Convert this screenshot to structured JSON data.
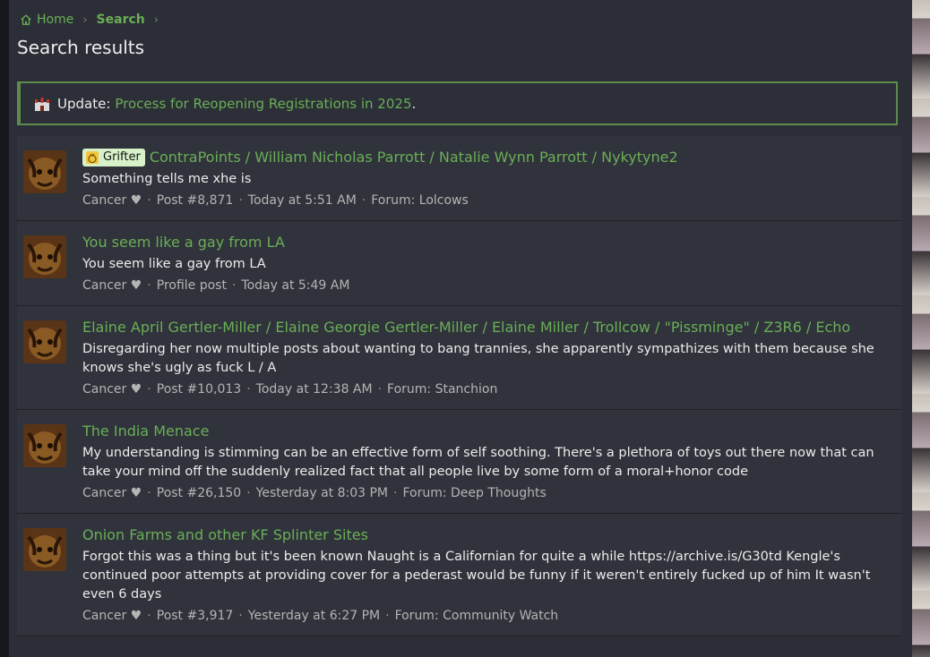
{
  "breadcrumb": {
    "home": "Home",
    "search": "Search"
  },
  "page_title": "Search results",
  "notice": {
    "lead": "Update:",
    "link": "Process for Reopening Registrations in 2025",
    "trail": "."
  },
  "results": [
    {
      "badge": "Grifter",
      "title": "ContraPoints / William Nicholas Parrott / Natalie Wynn Parrott / Nykytyne2",
      "snippet": "Something tells me xhe is",
      "author": "Cancer ♥",
      "type": "Post #8,871",
      "time": "Today at 5:51 AM",
      "forum": "Forum: Lolcows"
    },
    {
      "badge": "",
      "title": "You seem like a gay from LA",
      "snippet": "You seem like a gay from LA",
      "author": "Cancer ♥",
      "type": "Profile post",
      "time": "Today at 5:49 AM",
      "forum": ""
    },
    {
      "badge": "",
      "title": "Elaine April Gertler-Miller / Elaine Georgie Gertler-Miller / Elaine Miller / Trollcow / \"Pissminge\" / Z3R6 / Echo",
      "snippet": "Disregarding her now multiple posts about wanting to bang trannies, she apparently sympathizes with them because she knows she's ugly as fuck L / A",
      "author": "Cancer ♥",
      "type": "Post #10,013",
      "time": "Today at 12:38 AM",
      "forum": "Forum: Stanchion"
    },
    {
      "badge": "",
      "title": "The India Menace",
      "snippet": "My understanding is stimming can be an effective form of self soothing. There's a plethora of toys out there now that can take your mind off the suddenly realized fact that all people live by some form of a moral+honor code",
      "author": "Cancer ♥",
      "type": "Post #26,150",
      "time": "Yesterday at 8:03 PM",
      "forum": "Forum: Deep Thoughts"
    },
    {
      "badge": "",
      "title": "Onion Farms and other KF Splinter Sites",
      "snippet": "Forgot this was a thing but it's been known Naught is a Californian for quite a while https://archive.is/G30td Kengle's continued poor attempts at providing cover for a pederast would be funny if it weren't entirely fucked up of him It wasn't even 6 days",
      "author": "Cancer ♥",
      "type": "Post #3,917",
      "time": "Yesterday at 6:27 PM",
      "forum": "Forum: Community Watch"
    }
  ],
  "colors": {
    "accent": "#6aae57",
    "page_bg": "#2b2e36",
    "row_bg": "#30333b",
    "badge_bg": "#d7f2c9"
  },
  "icons": [
    "home-icon",
    "chevron-right-icon",
    "castle-icon",
    "money-bag-icon"
  ]
}
